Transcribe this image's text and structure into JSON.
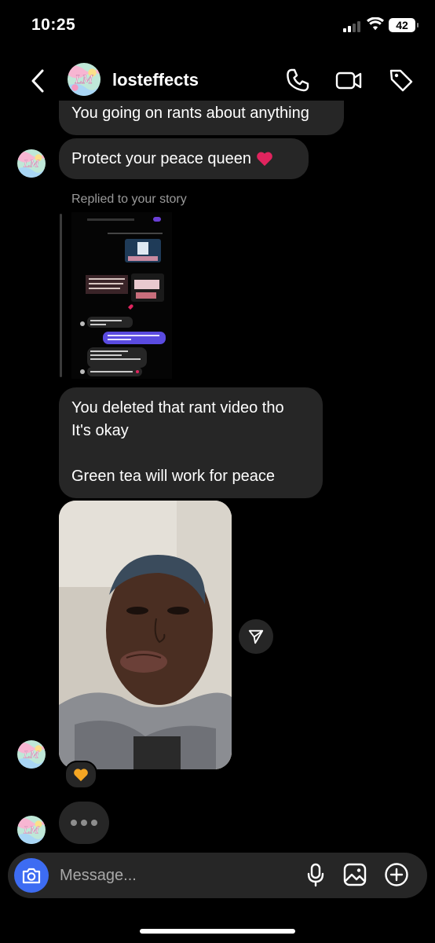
{
  "status_bar": {
    "time": "10:25",
    "battery": "42",
    "icons": [
      "signal-icon",
      "wifi-icon",
      "battery-icon"
    ]
  },
  "header": {
    "username": "losteffects",
    "icons": [
      "back-chevron-icon",
      "phone-icon",
      "video-camera-icon",
      "tag-icon"
    ]
  },
  "messages": {
    "rant_text": "You going on rants about anything",
    "peace_text": "Protect your peace queen",
    "peace_emoji": "red-heart-icon",
    "replied_label": "Replied to your story",
    "deleted_lines": [
      "You deleted that rant video tho",
      "It's okay",
      "",
      "Green tea will work for peace"
    ],
    "reaction_emoji": "orange-heart-icon"
  },
  "composer": {
    "placeholder": "Message...",
    "icons": [
      "camera-icon",
      "microphone-icon",
      "gallery-icon",
      "plus-icon"
    ]
  },
  "colors": {
    "bubble": "#262626",
    "camera_button": "#3d6cf2",
    "background": "#000000",
    "heart_red": "#e0245e",
    "heart_orange": "#f5a623"
  }
}
